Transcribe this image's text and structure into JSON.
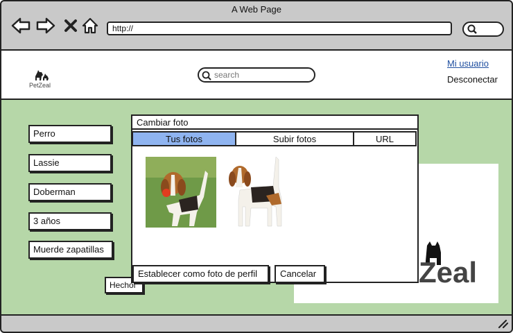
{
  "window": {
    "title": "A Web Page",
    "url": "http://"
  },
  "icons": {
    "back": "arrow-left-icon",
    "forward": "arrow-right-icon",
    "stop": "close-icon",
    "home": "home-icon",
    "search": "search-icon",
    "resize": "resize-grip-icon"
  },
  "header": {
    "logo_text": "PetZeal",
    "search_placeholder": "search",
    "user_link": "Mi usuario",
    "logout_link": "Desconectar"
  },
  "profile": {
    "fields": [
      "Perro",
      "Lassie",
      "Doberman",
      "3 años",
      "Muerde zapatillas"
    ],
    "done_label": "Hechol",
    "picture_logo_text": "Zeal"
  },
  "dialog": {
    "title": "Cambiar foto",
    "tabs": [
      "Tus fotos",
      "Subir fotos",
      "URL"
    ],
    "selected_tab": "Tus fotos",
    "photos": [
      "beagle-playing-with-ball-photo",
      "beagle-standing-photo"
    ],
    "set_profile_label": "Establecer como foto de perfil",
    "cancel_label": "Cancelar"
  },
  "colors": {
    "chrome": "#c9c9c9",
    "content_bg": "#b6d7a8",
    "selected_tab": "#8fb4f0",
    "link": "#1f4fa0"
  }
}
